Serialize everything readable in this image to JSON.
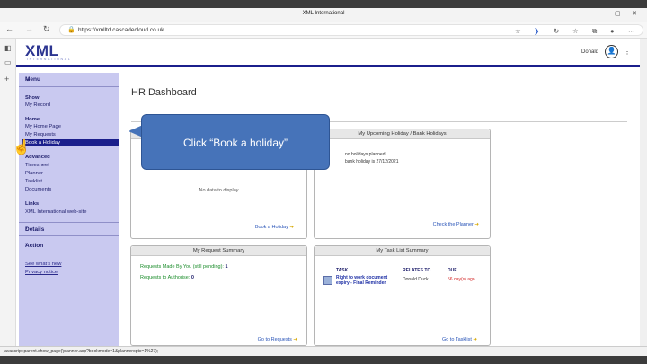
{
  "browser": {
    "window_title": "XML International",
    "url": "https://xmlltd.cascadecloud.co.uk",
    "min_label": "–",
    "max_label": "▢",
    "close_label": "✕",
    "more_label": "···"
  },
  "header": {
    "logo": "XML",
    "logo_sub": "INTERNATIONAL",
    "user_name": "Donald",
    "more": "⋮"
  },
  "leftnav": {
    "menu_label": "Menu",
    "show_section": "Show:",
    "my_record": "My Record",
    "home_section": "Home",
    "my_home_page": "My Home Page",
    "my_requests": "My Requests",
    "book_holiday": "Book a Holiday",
    "advanced_section": "Advanced",
    "timesheet": "Timesheet",
    "planner": "Planner",
    "tasklist": "Tasklist",
    "documents": "Documents",
    "links_section": "Links",
    "xml_website": "XML International web-site",
    "details_label": "Details",
    "action_label": "Action",
    "whats_new": "See what's new",
    "privacy": "Privacy notice"
  },
  "main": {
    "title": "HR Dashboard",
    "holiday_panel": {
      "no_data": "No data to display",
      "link": "Book a Holiday"
    },
    "upcoming_panel": {
      "title": "My Upcoming Holiday / Bank Holidays",
      "line1": "no holidays planned",
      "line2": "bank holiday is 27/12/2021",
      "link": "Check the Planner"
    },
    "request_panel": {
      "title": "My Request Summary",
      "made_label": "Requests Made By You (still pending):",
      "made_value": "1",
      "auth_label": "Requests to Authorise:",
      "auth_value": "0",
      "link": "Go to Requests"
    },
    "task_panel": {
      "title": "My Task List Summary",
      "col_task": "TASK",
      "col_relates": "RELATES TO",
      "col_due": "DUE",
      "task_name": "Right to work document expiry - Final Reminder",
      "task_relates": "Donald Duck",
      "task_due": "56 day(s) ago",
      "link": "Go to Tasklist"
    }
  },
  "callout": {
    "text": "Click  “Book a holiday”"
  },
  "status": {
    "text": "javascript:parent.show_page('planner.asp?bookmode=1&planneropts=1%27);"
  },
  "colors": {
    "brand": "#1b1f8c",
    "nav_bg": "#c9c9f0",
    "callout": "#4673b9",
    "overdue": "#d22020"
  }
}
